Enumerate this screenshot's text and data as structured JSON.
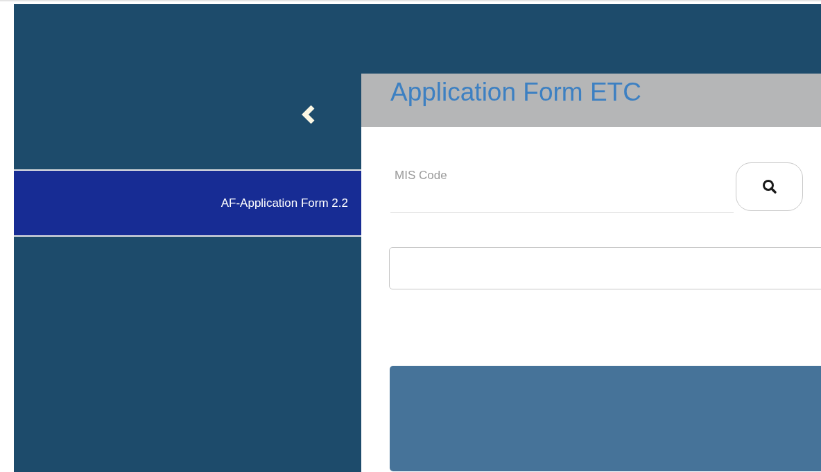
{
  "sidebar": {
    "items": [
      {
        "label": "AF-Application Form 2.2",
        "selected": true
      }
    ]
  },
  "main": {
    "title": "Application Form ETC",
    "fields": [
      {
        "kind": "search",
        "placeholder": "MIS Code"
      },
      {
        "kind": "text"
      }
    ]
  }
}
